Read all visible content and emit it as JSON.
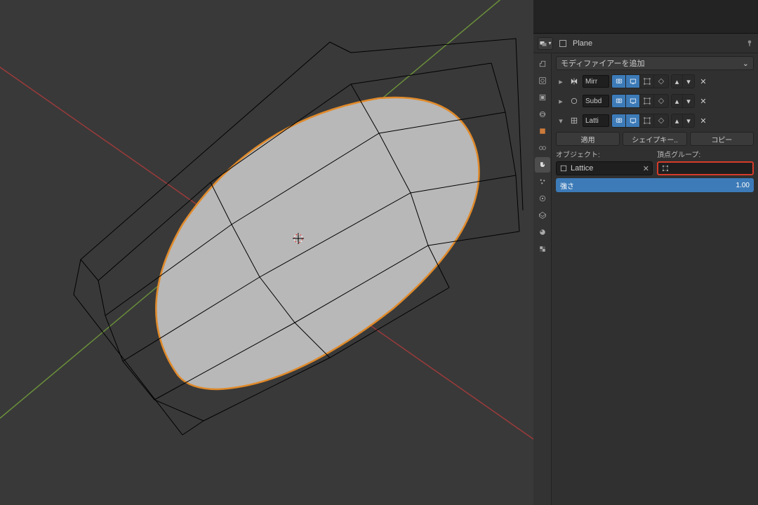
{
  "header": {
    "object_name": "Plane"
  },
  "modifiers": {
    "add_label": "モディファイアーを追加",
    "list": [
      {
        "expanded": "▸",
        "name": "Mirr",
        "icon": "mirror",
        "t_render": true,
        "t_realtime": true,
        "t_edit": false,
        "t_cage": false
      },
      {
        "expanded": "▸",
        "name": "Subd",
        "icon": "subdiv",
        "t_render": true,
        "t_realtime": true,
        "t_edit": false,
        "t_cage": false
      },
      {
        "expanded": "▾",
        "name": "Latti",
        "icon": "lattice",
        "t_render": true,
        "t_realtime": true,
        "t_edit": false,
        "t_cage": false
      }
    ],
    "apply_label": "適用",
    "shapekey_label": "シェイプキー..",
    "copy_label": "コピー",
    "object_label": "オブジェクト:",
    "vgroup_label": "頂点グループ:",
    "object_value": "Lattice",
    "vgroup_value": "",
    "strength_label": "強さ",
    "strength_value": "1.00"
  }
}
